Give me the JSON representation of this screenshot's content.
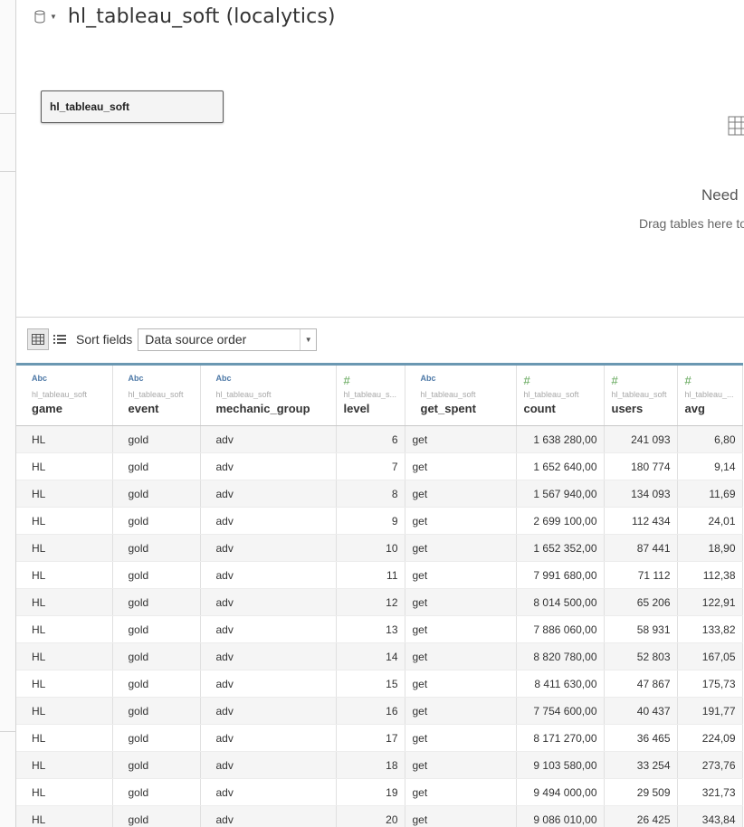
{
  "datasource": {
    "title": "hl_tableau_soft (localytics)",
    "icon": "database-icon"
  },
  "canvas": {
    "table_name": "hl_tableau_soft",
    "empty_heading": "Need",
    "empty_hint": "Drag tables here to"
  },
  "toolbar": {
    "sort_label": "Sort fields",
    "sort_value": "Data source order"
  },
  "columns": [
    {
      "type": "Abc",
      "source": "hl_tableau_soft",
      "name": "game"
    },
    {
      "type": "Abc",
      "source": "hl_tableau_soft",
      "name": "event"
    },
    {
      "type": "Abc",
      "source": "hl_tableau_soft",
      "name": "mechanic_group"
    },
    {
      "type": "#",
      "source": "hl_tableau_s...",
      "name": "level"
    },
    {
      "type": "Abc",
      "source": "hl_tableau_soft",
      "name": "get_spent"
    },
    {
      "type": "#",
      "source": "hl_tableau_soft",
      "name": "count"
    },
    {
      "type": "#",
      "source": "hl_tableau_soft",
      "name": "users"
    },
    {
      "type": "#",
      "source": "hl_tableau_...",
      "name": "avg"
    }
  ],
  "rows": [
    [
      "HL",
      "gold",
      "adv",
      "6",
      "get",
      "1 638 280,00",
      "241 093",
      "6,80"
    ],
    [
      "HL",
      "gold",
      "adv",
      "7",
      "get",
      "1 652 640,00",
      "180 774",
      "9,14"
    ],
    [
      "HL",
      "gold",
      "adv",
      "8",
      "get",
      "1 567 940,00",
      "134 093",
      "11,69"
    ],
    [
      "HL",
      "gold",
      "adv",
      "9",
      "get",
      "2 699 100,00",
      "112 434",
      "24,01"
    ],
    [
      "HL",
      "gold",
      "adv",
      "10",
      "get",
      "1 652 352,00",
      "87 441",
      "18,90"
    ],
    [
      "HL",
      "gold",
      "adv",
      "11",
      "get",
      "7 991 680,00",
      "71 112",
      "112,38"
    ],
    [
      "HL",
      "gold",
      "adv",
      "12",
      "get",
      "8 014 500,00",
      "65 206",
      "122,91"
    ],
    [
      "HL",
      "gold",
      "adv",
      "13",
      "get",
      "7 886 060,00",
      "58 931",
      "133,82"
    ],
    [
      "HL",
      "gold",
      "adv",
      "14",
      "get",
      "8 820 780,00",
      "52 803",
      "167,05"
    ],
    [
      "HL",
      "gold",
      "adv",
      "15",
      "get",
      "8 411 630,00",
      "47 867",
      "175,73"
    ],
    [
      "HL",
      "gold",
      "adv",
      "16",
      "get",
      "7 754 600,00",
      "40 437",
      "191,77"
    ],
    [
      "HL",
      "gold",
      "adv",
      "17",
      "get",
      "8 171 270,00",
      "36 465",
      "224,09"
    ],
    [
      "HL",
      "gold",
      "adv",
      "18",
      "get",
      "9 103 580,00",
      "33 254",
      "273,76"
    ],
    [
      "HL",
      "gold",
      "adv",
      "19",
      "get",
      "9 494 000,00",
      "29 509",
      "321,73"
    ],
    [
      "HL",
      "gold",
      "adv",
      "20",
      "get",
      "9 086 010,00",
      "26 425",
      "343,84"
    ]
  ],
  "colors": {
    "header_accent": "#6b98b2",
    "string_type": "#4e79a7",
    "number_type": "#59a14f",
    "odd_row": "#f5f5f5"
  }
}
